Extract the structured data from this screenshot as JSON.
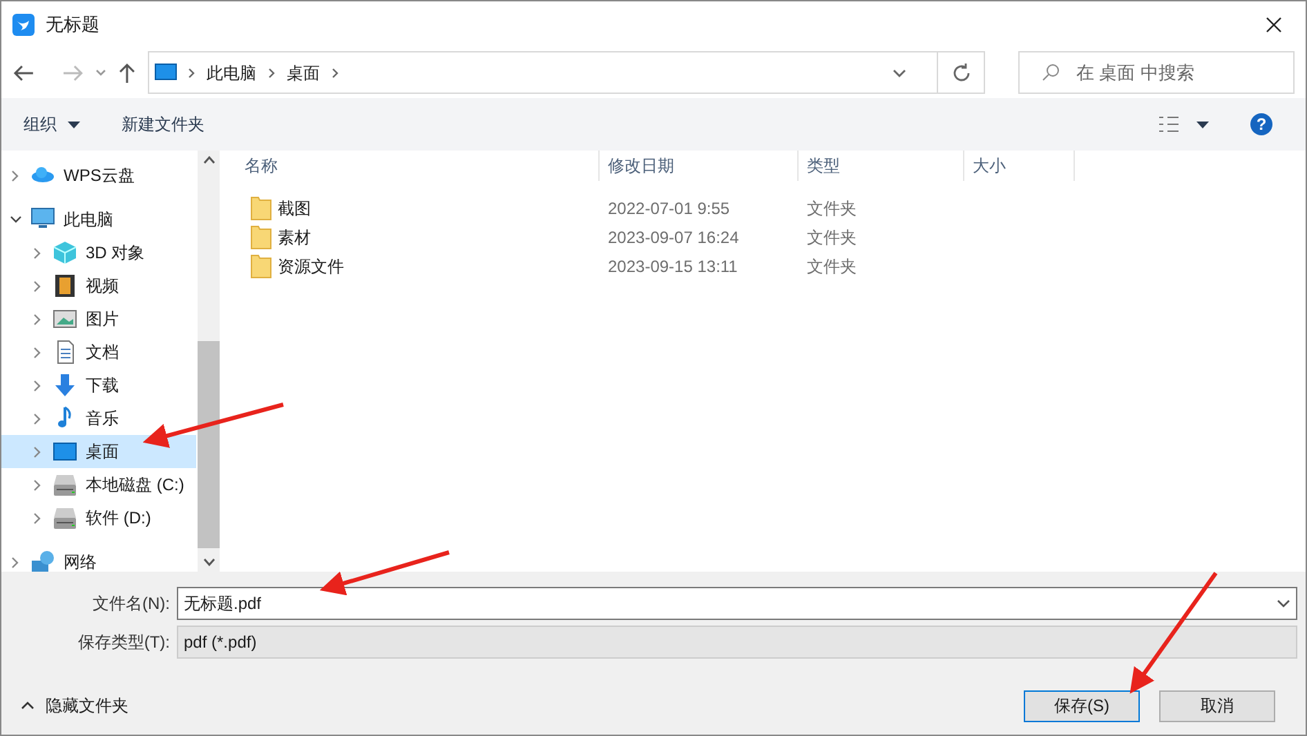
{
  "window": {
    "title": "无标题"
  },
  "address": {
    "path": [
      "此电脑",
      "桌面"
    ]
  },
  "search": {
    "placeholder": "在 桌面 中搜索"
  },
  "toolbar": {
    "organize": "组织",
    "new_folder": "新建文件夹",
    "help": "?"
  },
  "nav": [
    {
      "label": "WPS云盘",
      "kind": "cloud",
      "expanded": false,
      "selected": false
    },
    {
      "label": "此电脑",
      "kind": "pc",
      "expanded": true,
      "selected": false,
      "children": [
        {
          "label": "3D 对象",
          "kind": "cube",
          "expanded": false,
          "selected": false
        },
        {
          "label": "视频",
          "kind": "film",
          "expanded": false,
          "selected": false
        },
        {
          "label": "图片",
          "kind": "image",
          "expanded": false,
          "selected": false
        },
        {
          "label": "文档",
          "kind": "doc",
          "expanded": false,
          "selected": false
        },
        {
          "label": "下载",
          "kind": "download",
          "expanded": false,
          "selected": false
        },
        {
          "label": "音乐",
          "kind": "music",
          "expanded": false,
          "selected": false
        },
        {
          "label": "桌面",
          "kind": "desktop",
          "expanded": false,
          "selected": true
        },
        {
          "label": "本地磁盘 (C:)",
          "kind": "drive",
          "expanded": false,
          "selected": false
        },
        {
          "label": "软件 (D:)",
          "kind": "drive",
          "expanded": false,
          "selected": false
        }
      ]
    },
    {
      "label": "网络",
      "kind": "network",
      "expanded": false,
      "selected": false
    }
  ],
  "table": {
    "columns": [
      "名称",
      "修改日期",
      "类型",
      "大小"
    ],
    "rows": [
      {
        "name": "截图",
        "modified": "2022-07-01 9:55",
        "type": "文件夹"
      },
      {
        "name": "素材",
        "modified": "2023-09-07 16:24",
        "type": "文件夹"
      },
      {
        "name": "资源文件",
        "modified": "2023-09-15 13:11",
        "type": "文件夹"
      }
    ]
  },
  "file_name": {
    "label": "文件名(N):",
    "value": "无标题.pdf"
  },
  "save_type": {
    "label": "保存类型(T):",
    "value": "pdf (*.pdf)"
  },
  "hide_folders": "隐藏文件夹",
  "buttons": [
    "保存(S)",
    "取消"
  ]
}
